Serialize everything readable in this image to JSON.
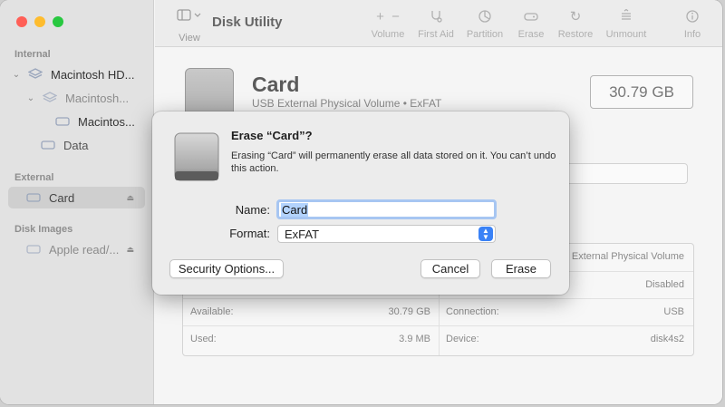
{
  "window": {
    "title": "Disk Utility"
  },
  "sidebar": {
    "sections": [
      {
        "title": "Internal"
      },
      {
        "title": "External"
      },
      {
        "title": "Disk Images"
      }
    ],
    "items": [
      {
        "label": "Macintosh HD..."
      },
      {
        "label": "Macintosh..."
      },
      {
        "label": "Macintos..."
      },
      {
        "label": "Data"
      },
      {
        "label": "Card"
      },
      {
        "label": "Apple read/..."
      }
    ]
  },
  "toolbar": {
    "view_label": "View",
    "buttons": [
      {
        "label": "Volume",
        "icon": "plus-minus-icon"
      },
      {
        "label": "First Aid",
        "icon": "stethoscope-icon"
      },
      {
        "label": "Partition",
        "icon": "pie-icon"
      },
      {
        "label": "Erase",
        "icon": "eraser-icon"
      },
      {
        "label": "Restore",
        "icon": "restore-icon"
      },
      {
        "label": "Unmount",
        "icon": "unmount-icon"
      },
      {
        "label": "Info",
        "icon": "info-icon"
      }
    ]
  },
  "volume": {
    "name": "Card",
    "subtitle": "USB External Physical Volume • ExFAT",
    "size": "30.79 GB"
  },
  "info": {
    "rows": [
      {
        "left_label": "",
        "left_value": "",
        "right_label": "",
        "right_value": "External Physical Volume"
      },
      {
        "left_label": "",
        "left_value": "",
        "right_label": "",
        "right_value": "Disabled"
      },
      {
        "left_label": "Available:",
        "left_value": "30.79 GB",
        "right_label": "Connection:",
        "right_value": "USB"
      },
      {
        "left_label": "Used:",
        "left_value": "3.9 MB",
        "right_label": "Device:",
        "right_value": "disk4s2"
      }
    ]
  },
  "dialog": {
    "title": "Erase “Card”?",
    "message": "Erasing “Card” will permanently erase all data stored on it. You can’t undo this action.",
    "name_label": "Name:",
    "name_value": "Card",
    "format_label": "Format:",
    "format_value": "ExFAT",
    "security_button": "Security Options...",
    "cancel_button": "Cancel",
    "erase_button": "Erase"
  }
}
